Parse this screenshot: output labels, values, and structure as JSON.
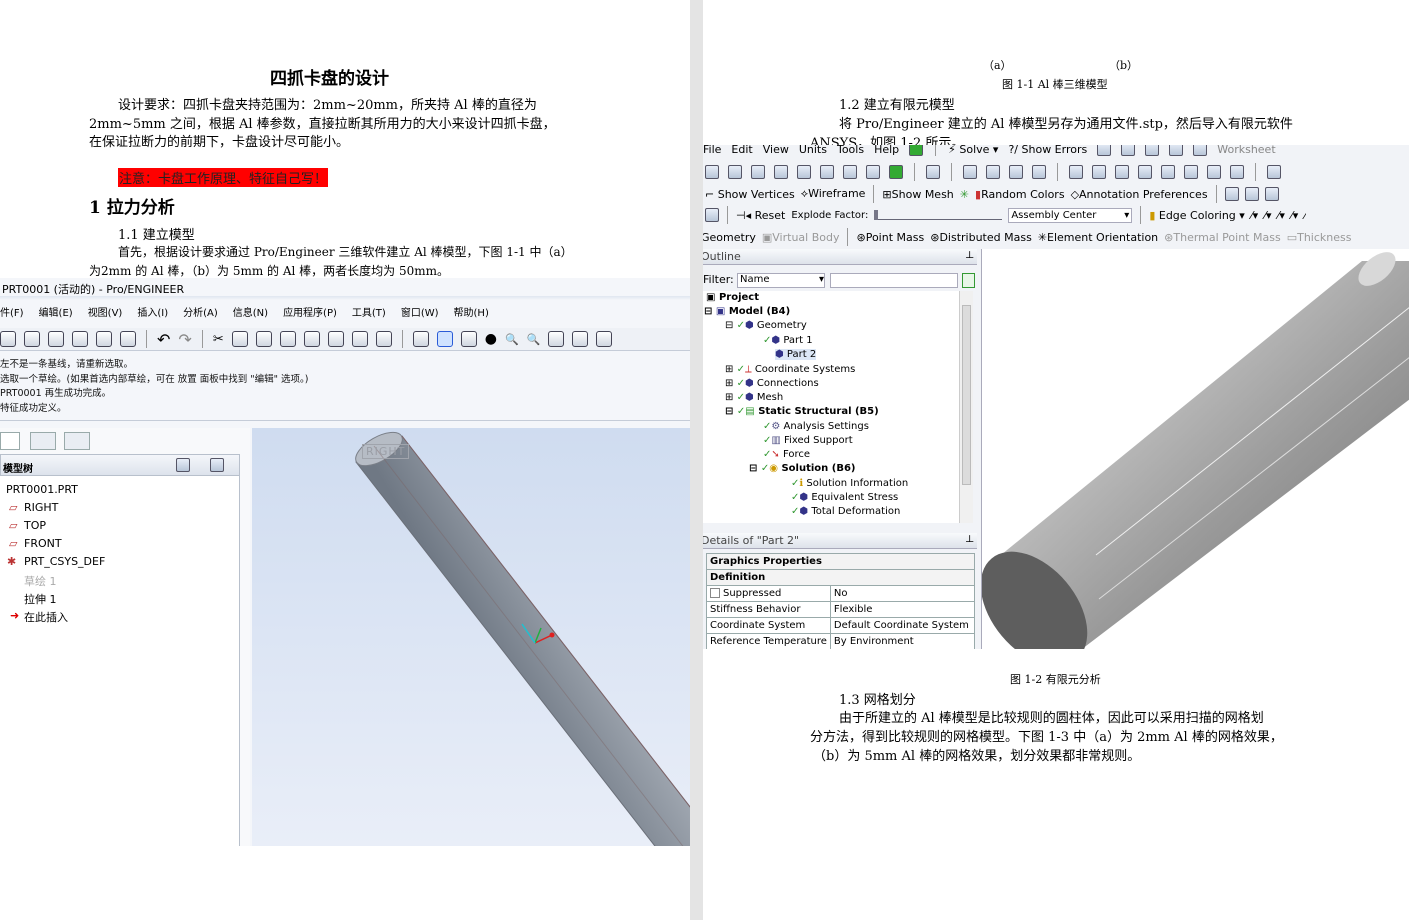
{
  "left_page": {
    "title": "四抓卡盘的设计",
    "para1_l1": "设计要求：四抓卡盘夹持范围为：2mm~20mm，所夹持 Al 棒的直径为",
    "para1_l2": "2mm~5mm 之间，根据 Al 棒参数，直接拉断其所用力的大小来设计四抓卡盘，",
    "para1_l3": "在保证拉断力的前期下，卡盘设计尽可能小。",
    "note": "注意：卡盘工作原理、特征自己写！",
    "heading1": "1 拉力分析",
    "sub11": "1.1 建立模型",
    "para2_l1": "首先，根据设计要求通过 Pro/Engineer 三维软件建立 Al 棒模型，下图 1-1 中（a）",
    "para2_l2": "为2mm 的 Al 棒，（b）为 5mm 的 Al 棒，两者长度均为 50mm。",
    "proe": {
      "window_title": "PRT0001 (活动的) - Pro/ENGINEER",
      "menu": [
        "件(F)",
        "编辑(E)",
        "视图(V)",
        "插入(I)",
        "分析(A)",
        "信息(N)",
        "应用程序(P)",
        "工具(T)",
        "窗口(W)",
        "帮助(H)"
      ],
      "messages": [
        "左不是一条基线，请重新选取。",
        "选取一个草绘。(如果首选内部草绘，可在 放置 面板中找到 \"编辑\" 选项。)",
        "PRT0001 再生成功完成。",
        "特征成功定义。"
      ],
      "tree_header": "模型树",
      "tree": [
        "PRT0001.PRT",
        "RIGHT",
        "TOP",
        "FRONT",
        "PRT_CSYS_DEF",
        "草绘 1",
        "拉伸 1",
        "在此插入"
      ],
      "datum_label": "RIGHT"
    }
  },
  "right_page": {
    "cap_a": "（a）",
    "cap_b": "（b）",
    "fig11": "图 1-1 Al 棒三维模型",
    "sub12": "1.2 建立有限元模型",
    "para3_l1": "将 Pro/Engineer 建立的 Al 棒模型另存为通用文件.stp，然后导入有限元软件",
    "para3_l2": "ANSYS，如图 1-2 所示。",
    "ansys": {
      "menu": [
        "File",
        "Edit",
        "View",
        "Units",
        "Tools",
        "Help"
      ],
      "solve": "Solve",
      "show_errors": "?/ Show Errors",
      "worksheet": "Worksheet",
      "tb3": [
        "Show Vertices",
        "Wireframe",
        "Show Mesh",
        "Random Colors",
        "Annotation Preferences"
      ],
      "reset": "Reset",
      "explode": "Explode Factor:",
      "assembly_center": "Assembly Center",
      "edge_coloring": "Edge Coloring",
      "tb5": [
        "Geometry",
        "Virtual Body",
        "Point Mass",
        "Distributed Mass",
        "Element Orientation",
        "Thermal Point Mass",
        "Thickness"
      ],
      "outline": "Outline",
      "filter_label": "Filter:",
      "filter_value": "Name",
      "tree": [
        "Project",
        "Model (B4)",
        "Geometry",
        "Part 1",
        "Part 2",
        "Coordinate Systems",
        "Connections",
        "Mesh",
        "Static Structural (B5)",
        "Analysis Settings",
        "Fixed Support",
        "Force",
        "Solution (B6)",
        "Solution Information",
        "Equivalent Stress",
        "Total Deformation"
      ],
      "details_title": "Details of \"Part 2\"",
      "details": {
        "section1": "Graphics Properties",
        "section2": "Definition",
        "rows": [
          [
            "Suppressed",
            "No"
          ],
          [
            "Stiffness Behavior",
            "Flexible"
          ],
          [
            "Coordinate System",
            "Default Coordinate System"
          ],
          [
            "Reference Temperature",
            "By Environment"
          ]
        ]
      }
    },
    "fig12": "图 1-2 有限元分析",
    "sub13": "1.3 网格划分",
    "para4_l1": "由于所建立的 Al 棒模型是比较规则的圆柱体，因此可以采用扫描的网格划",
    "para4_l2": "分方法，得到比较规则的网格模型。下图 1-3 中（a）为 2mm Al 棒的网格效果，",
    "para4_l3": "（b）为 5mm Al 棒的网格效果，划分效果都非常规则。"
  }
}
